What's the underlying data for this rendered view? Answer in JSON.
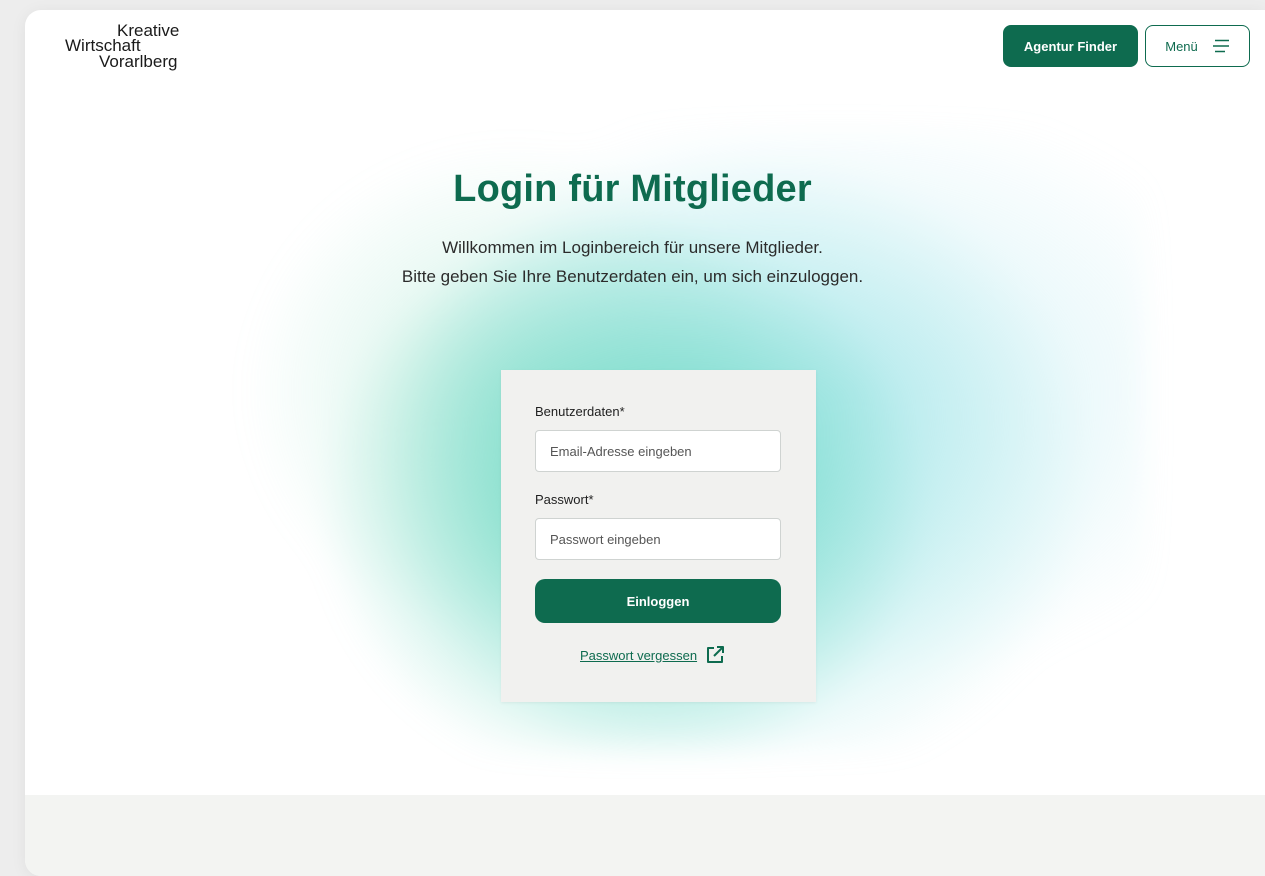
{
  "brand": {
    "logo_line1": "Kreative",
    "logo_line2": "Wirtschaft",
    "logo_line3": "Vorarlberg"
  },
  "header": {
    "agentur_finder_label": "Agentur Finder",
    "menu_label": "Menü",
    "menu_icon": "hamburger-icon"
  },
  "main": {
    "title": "Login für Mitglieder",
    "subtitle_line1": "Willkommen im Loginbereich für unsere Mitglieder.",
    "subtitle_line2": "Bitte geben Sie Ihre Benutzerdaten ein, um sich einzuloggen."
  },
  "form": {
    "user_label": "Benutzerdaten*",
    "user_placeholder": "Email-Adresse eingeben",
    "user_value": "",
    "password_label": "Passwort*",
    "password_placeholder": "Passwort eingeben",
    "password_value": "",
    "login_button": "Einloggen",
    "forgot_link": "Passwort vergessen",
    "forgot_icon": "external-link-icon"
  },
  "colors": {
    "brand_green": "#0e6b4f",
    "card_background": "#f1f1ef",
    "page_background": "#ffffff"
  }
}
